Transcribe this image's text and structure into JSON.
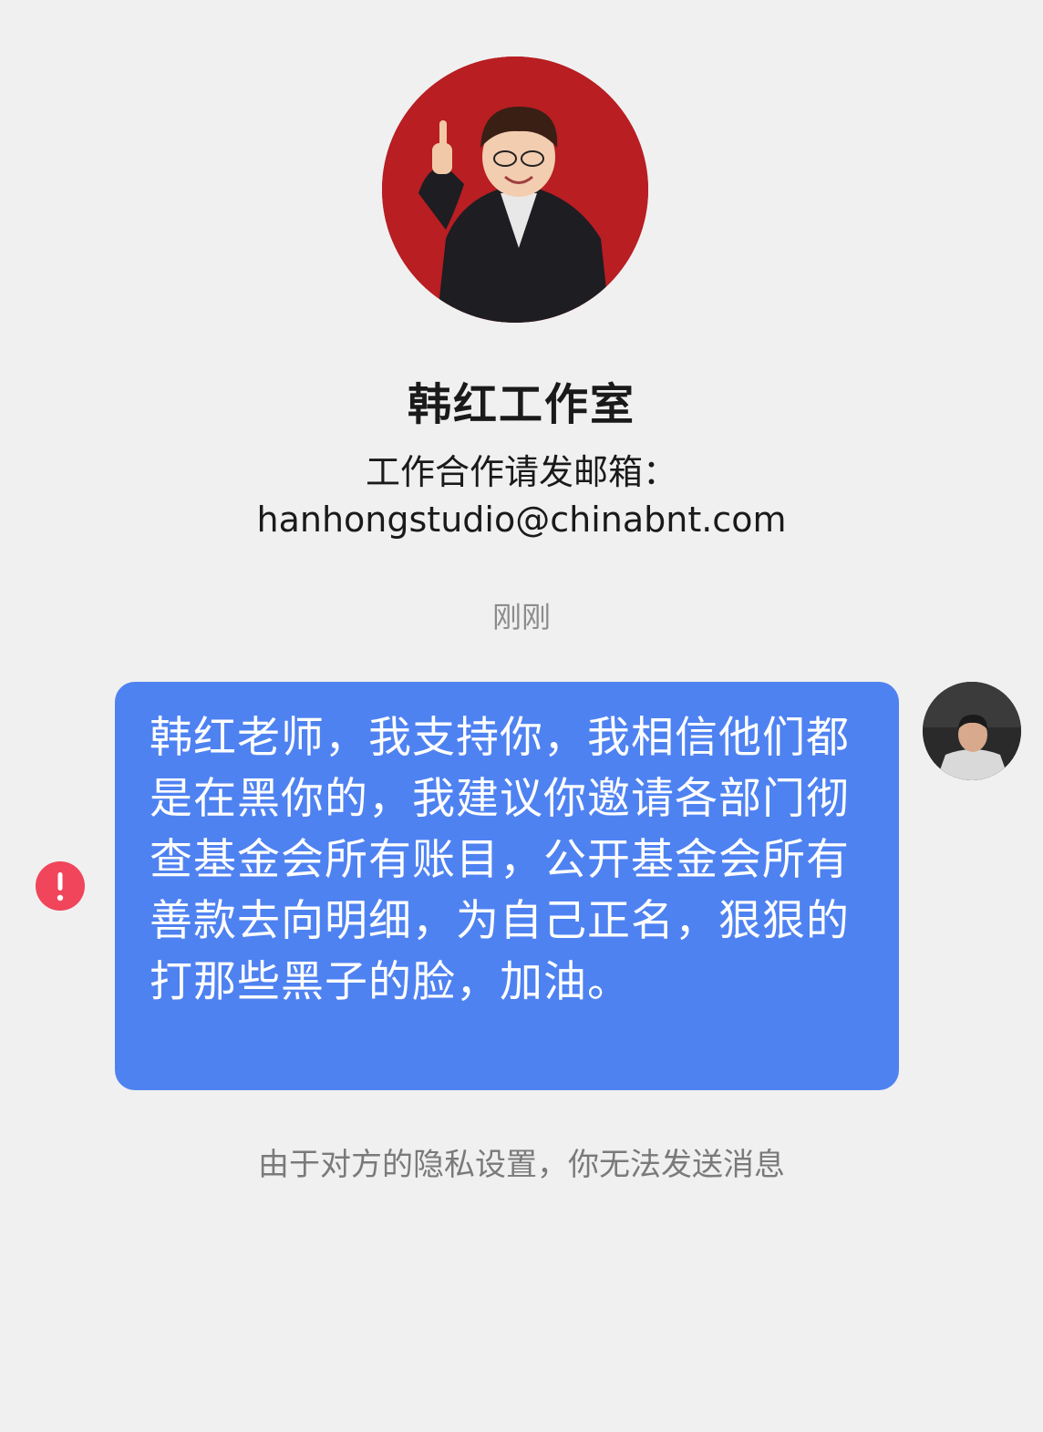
{
  "profile": {
    "name": "韩红工作室",
    "bio_line1": "工作合作请发邮箱：",
    "bio_line2": "hanhongstudio@chinabnt.com",
    "avatar_icon": "profile-photo-icon"
  },
  "chat": {
    "timestamp": "刚刚",
    "messages": [
      {
        "sender": "me",
        "text": "韩红老师，我支持你，我相信他们都是在黑你的，我建议你邀请各部门彻查基金会所有账目，公开基金会所有善款去向明细，为自己正名，狠狠的打那些黑子的脸，加油。",
        "status_icon": "send-failed-icon"
      }
    ]
  },
  "notice": "由于对方的隐私设置，你无法发送消息",
  "colors": {
    "background": "#f0f0f0",
    "bubble": "#4f82f1",
    "error": "#f0455a",
    "avatar_bg": "#b81e22"
  }
}
